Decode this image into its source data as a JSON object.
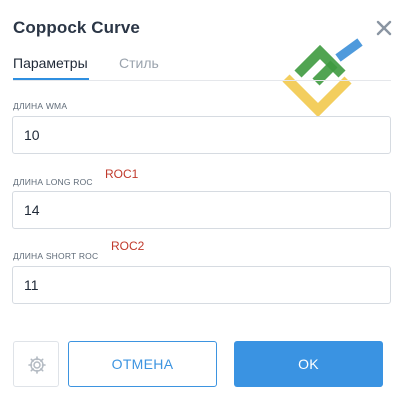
{
  "dialog": {
    "title": "Coppock Curve",
    "close_icon": "close-icon"
  },
  "tabs": [
    {
      "label": "Параметры",
      "active": true
    },
    {
      "label": "Стиль",
      "active": false
    }
  ],
  "fields": {
    "wma": {
      "label": "ДЛИНА WMA",
      "value": "10"
    },
    "long_roc": {
      "label": "ДЛИНА LONG ROC",
      "value": "14",
      "annotation": "ROC1"
    },
    "short_roc": {
      "label": "ДЛИНА SHORT ROC",
      "value": "11",
      "annotation": "ROC2"
    }
  },
  "buttons": {
    "defaults_icon": "settings-reset-icon",
    "cancel": "ОТМЕНА",
    "ok": "OK"
  },
  "colors": {
    "accent": "#3a93e2",
    "annotation": "#c0392b",
    "logo_green": "#3e9a3f",
    "logo_yellow": "#f2c94c",
    "logo_blue": "#3b8fd8"
  }
}
